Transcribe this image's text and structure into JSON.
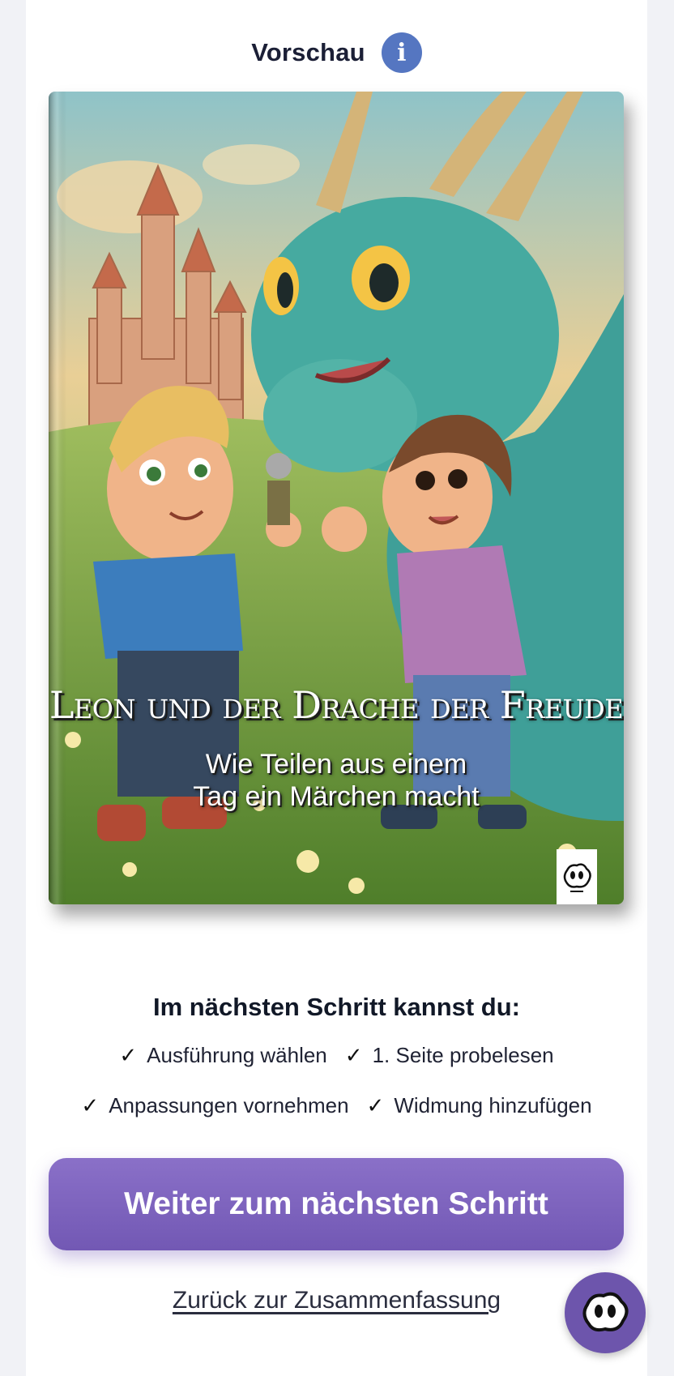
{
  "preview": {
    "title": "Vorschau",
    "info_icon": "info-icon",
    "info_glyph": "i"
  },
  "book": {
    "title": "Leon und der Drache der Freude",
    "subtitle_line1": "Wie Teilen aus einem",
    "subtitle_line2": "Tag ein Märchen macht",
    "publisher_icon": "mascot-logo-icon"
  },
  "next_step": {
    "heading": "Im nächsten Schritt kannst du:",
    "items": [
      "Ausführung wählen",
      "1. Seite probelesen",
      "Anpassungen vornehmen",
      "Widmung hinzufügen"
    ],
    "check_glyph": "✓"
  },
  "actions": {
    "continue_label": "Weiter zum nächsten Schritt",
    "back_label": "Zurück zur Zusammenfassung",
    "chat_icon": "mascot-chat-icon"
  },
  "colors": {
    "accent": "#7258b4",
    "info": "#5576c1",
    "page_bg": "#f1f2f6"
  }
}
